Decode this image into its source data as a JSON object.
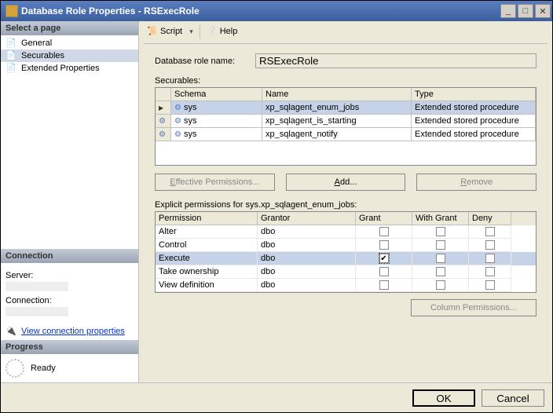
{
  "window": {
    "title": "Database Role Properties - RSExecRole"
  },
  "sidebar": {
    "selectPage": "Select a page",
    "items": [
      {
        "label": "General"
      },
      {
        "label": "Securables"
      },
      {
        "label": "Extended Properties"
      }
    ],
    "connection": {
      "header": "Connection",
      "serverLabel": "Server:",
      "connLabel": "Connection:",
      "viewProps": "View connection properties"
    },
    "progress": {
      "header": "Progress",
      "status": "Ready"
    }
  },
  "toolbar": {
    "script": "Script",
    "help": "Help"
  },
  "form": {
    "roleNameLabel": "Database role name:",
    "roleName": "RSExecRole",
    "securablesLabel": "Securables:"
  },
  "securablesGrid": {
    "columns": {
      "schema": "Schema",
      "name": "Name",
      "type": "Type"
    },
    "rows": [
      {
        "schema": "sys",
        "name": "xp_sqlagent_enum_jobs",
        "type": "Extended stored procedure",
        "selected": true
      },
      {
        "schema": "sys",
        "name": "xp_sqlagent_is_starting",
        "type": "Extended stored procedure",
        "selected": false
      },
      {
        "schema": "sys",
        "name": "xp_sqlagent_notify",
        "type": "Extended stored procedure",
        "selected": false
      }
    ]
  },
  "buttons": {
    "effective": "Effective Permissions...",
    "add": "Add...",
    "remove": "Remove"
  },
  "explicit": {
    "label": "Explicit permissions for sys.xp_sqlagent_enum_jobs:",
    "columns": {
      "permission": "Permission",
      "grantor": "Grantor",
      "grant": "Grant",
      "withGrant": "With Grant",
      "deny": "Deny"
    },
    "rows": [
      {
        "perm": "Alter",
        "grantor": "dbo",
        "grant": false,
        "withGrant": false,
        "deny": false,
        "selected": false
      },
      {
        "perm": "Control",
        "grantor": "dbo",
        "grant": false,
        "withGrant": false,
        "deny": false,
        "selected": false
      },
      {
        "perm": "Execute",
        "grantor": "dbo",
        "grant": true,
        "withGrant": false,
        "deny": false,
        "selected": true
      },
      {
        "perm": "Take ownership",
        "grantor": "dbo",
        "grant": false,
        "withGrant": false,
        "deny": false,
        "selected": false
      },
      {
        "perm": "View definition",
        "grantor": "dbo",
        "grant": false,
        "withGrant": false,
        "deny": false,
        "selected": false
      }
    ]
  },
  "colPerms": "Column Permissions...",
  "footer": {
    "ok": "OK",
    "cancel": "Cancel"
  }
}
